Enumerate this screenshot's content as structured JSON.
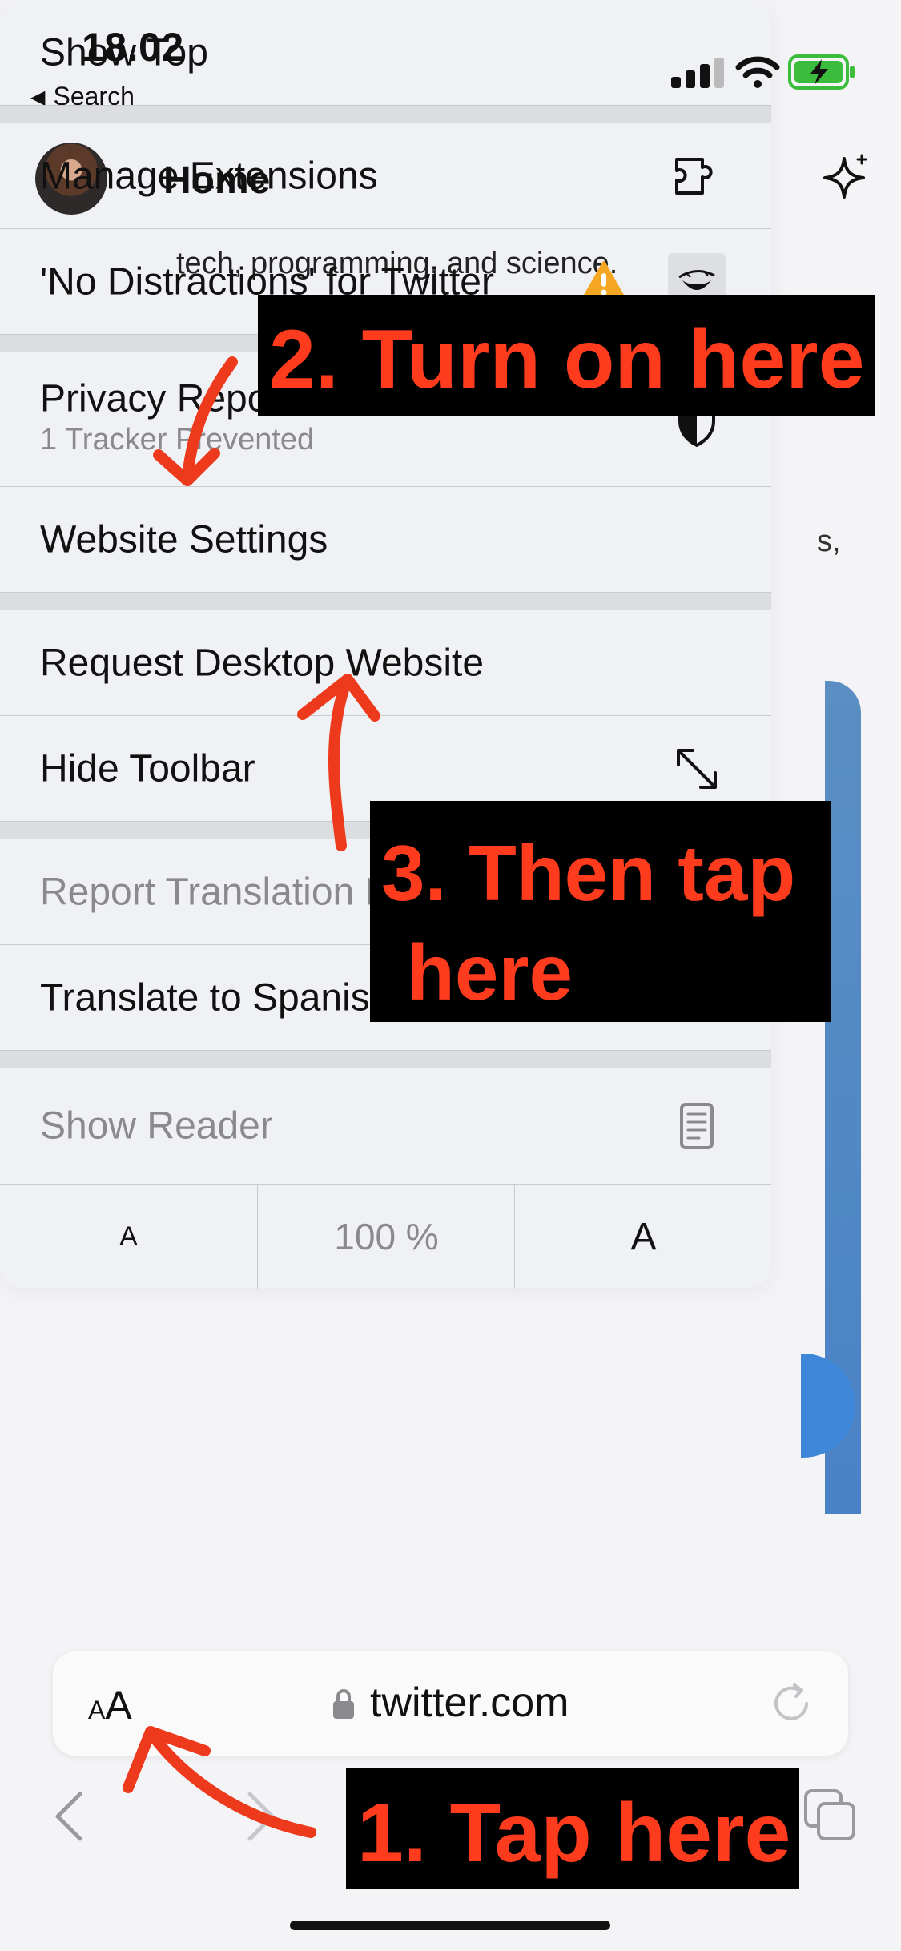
{
  "status_bar": {
    "time": "18.02",
    "back_label": "Search"
  },
  "header": {
    "title": "Home"
  },
  "background": {
    "snippet": "tech, programming, and science.",
    "snippet_right": "s,"
  },
  "menu": {
    "show_top_label": "Show Top",
    "manage_extensions_label": "Manage Extensions",
    "extension_label": "'No Distractions' for Twitter",
    "privacy_report_label": "Privacy Report",
    "privacy_report_sub": "1 Tracker Prevented",
    "website_settings_label": "Website Settings",
    "request_desktop_label": "Request Desktop Website",
    "hide_toolbar_label": "Hide Toolbar",
    "report_translation_label": "Report Translation Issue",
    "translate_label": "Translate to Spanish",
    "show_reader_label": "Show Reader",
    "font_smaller": "A",
    "zoom_level": "100 %",
    "font_larger": "A"
  },
  "address_bar": {
    "aa_small": "A",
    "aa_large": "A",
    "url": "twitter.com"
  },
  "annotations": {
    "step1": "1. Tap here",
    "step2": "2. Turn on here",
    "step3_line1": "3. Then tap",
    "step3_line2": "here"
  },
  "colors": {
    "annotation_text": "#ff3b1e",
    "annotation_bg": "#000000",
    "warning": "#f5a623",
    "link_blue": "#3d86d8"
  },
  "icons": {
    "manage_extensions": "puzzle-icon",
    "extension_warning": "warning-icon",
    "extension_logo": "extension-logo-icon",
    "privacy_report": "shield-icon",
    "hide_toolbar": "expand-arrows-icon",
    "report_translation": "speech-bubble-exclamation-icon",
    "translate": "translate-icon",
    "show_reader": "reader-document-icon"
  }
}
